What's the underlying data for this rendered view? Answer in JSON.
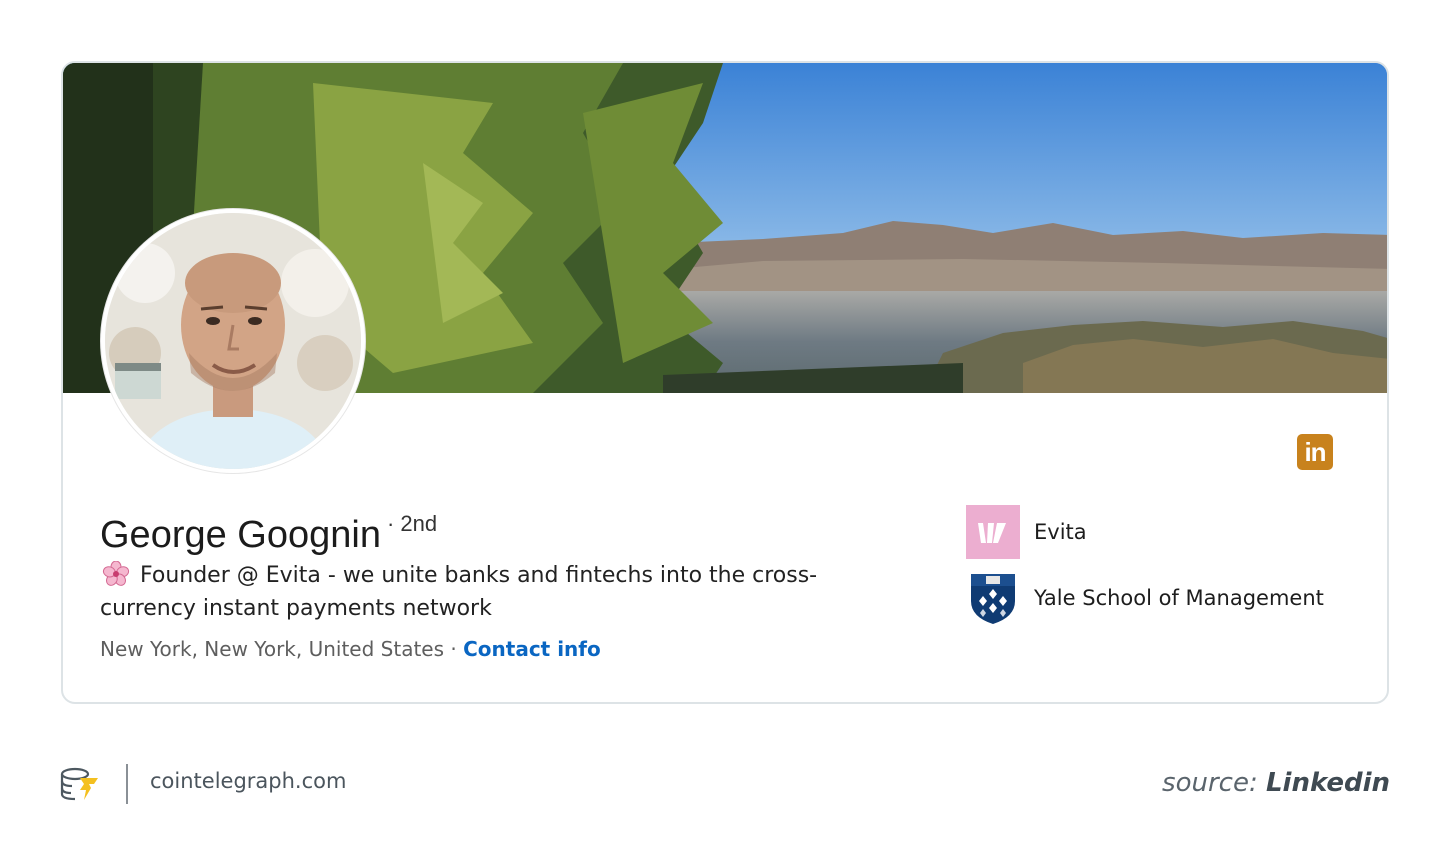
{
  "profile": {
    "name": "George Goognin",
    "degree": "· 2nd",
    "headline_icon": "cherry-blossom-icon",
    "headline": "Founder @ Evita - we unite banks and fintechs into the cross-currency instant payments network",
    "location": "New York, New York, United States ·",
    "contact_link": "Contact info"
  },
  "organizations": [
    {
      "name": "Evita",
      "icon": "evita-logo",
      "color": "#ecaed0"
    },
    {
      "name": "Yale School of Management",
      "icon": "yale-shield-logo",
      "color": "#0f3b73"
    }
  ],
  "linkedin_badge": {
    "text": "in",
    "color": "#c8821d"
  },
  "footer": {
    "site": "cointelegraph.com",
    "source_prefix": "source:",
    "source_name": "Linkedin"
  },
  "colors": {
    "link": "#0a66c2",
    "card_border": "#dde3e6"
  }
}
